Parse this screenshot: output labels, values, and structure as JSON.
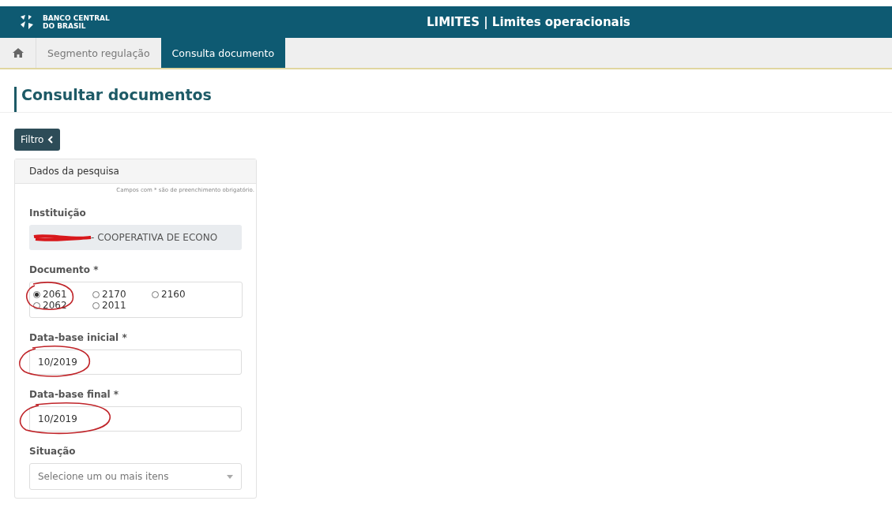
{
  "header": {
    "logo_line_1": "BANCO CENTRAL",
    "logo_line_2": "DO BRASIL",
    "title": "LIMITES | Limites operacionais"
  },
  "nav": {
    "tabs": [
      {
        "label": "Segmento regulação",
        "selected": false
      },
      {
        "label": "Consulta documento",
        "selected": true
      }
    ]
  },
  "page_title": "Consultar documentos",
  "filter_button": "Filtro",
  "panel": {
    "title": "Dados da pesquisa",
    "required_note": "Campos com * são de preenchimento obrigatório.",
    "institution": {
      "label": "Instituição",
      "value": "- COOPERATIVA DE ECONO"
    },
    "document": {
      "label": "Documento *",
      "options": [
        {
          "label": "2061",
          "selected": true
        },
        {
          "label": "2170",
          "selected": false
        },
        {
          "label": "2160",
          "selected": false
        },
        {
          "label": "2062",
          "selected": false
        },
        {
          "label": "2011",
          "selected": false
        }
      ]
    },
    "start_date": {
      "label": "Data-base inicial *",
      "value": "10/2019"
    },
    "end_date": {
      "label": "Data-base final *",
      "value": "10/2019"
    },
    "status": {
      "label": "Situação",
      "placeholder": "Selecione um ou mais itens"
    }
  }
}
